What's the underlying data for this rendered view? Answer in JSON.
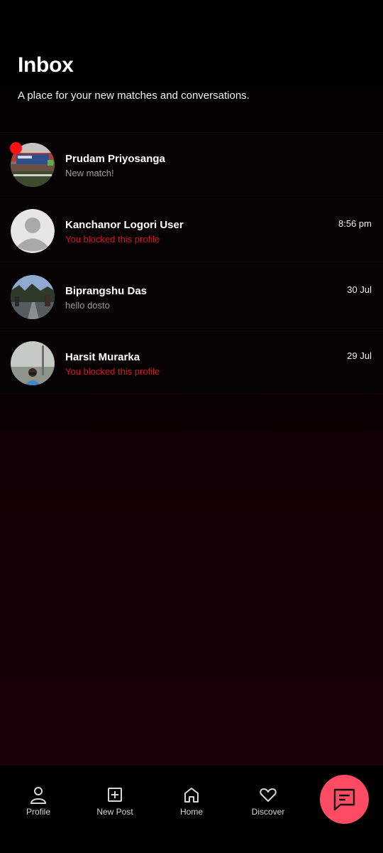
{
  "header": {
    "title": "Inbox",
    "subtitle": "A place for your new matches and conversations."
  },
  "conversations": [
    {
      "name": "Prudam Priyosanga",
      "message": "New match!",
      "time": "",
      "status": "normal",
      "unread": true,
      "avatar": "stadium-photo"
    },
    {
      "name": "Kanchanor Logori User",
      "message": "You blocked this profile",
      "time": "8:56 pm",
      "status": "blocked",
      "unread": false,
      "avatar": "default-person-icon"
    },
    {
      "name": "Biprangshu Das",
      "message": "hello dosto",
      "time": "30 Jul",
      "status": "normal",
      "unread": false,
      "avatar": "outdoor-photo"
    },
    {
      "name": "Harsit Murarka",
      "message": "You blocked this profile",
      "time": "29 Jul",
      "status": "blocked",
      "unread": false,
      "avatar": "person-photo"
    }
  ],
  "nav": {
    "items": [
      {
        "label": "Profile",
        "icon": "person-icon"
      },
      {
        "label": "New Post",
        "icon": "plus-square-icon"
      },
      {
        "label": "Home",
        "icon": "home-icon"
      },
      {
        "label": "Discover",
        "icon": "heart-icon"
      }
    ],
    "fab_icon": "chat-icon"
  },
  "colors": {
    "background": "#000000",
    "accent": "#ff4b63",
    "blocked_text": "#d6171f",
    "unread_dot": "#ff1111"
  }
}
